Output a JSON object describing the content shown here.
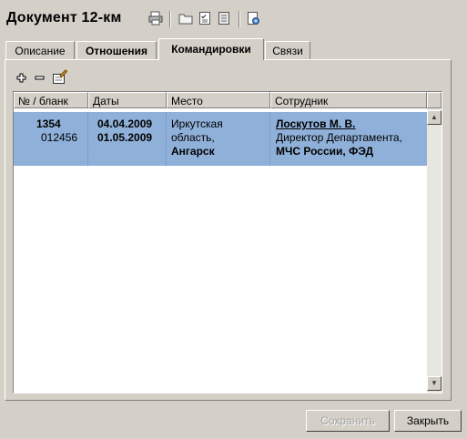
{
  "window": {
    "title": "Документ 12-км"
  },
  "toolbar": {
    "icons": [
      "print-icon",
      "folder-icon",
      "checklist-icon",
      "document-icon",
      "report-icon"
    ]
  },
  "tabs": [
    {
      "label": "Описание",
      "active": false
    },
    {
      "label": "Отношения",
      "active": false
    },
    {
      "label": "Командировки",
      "active": true
    },
    {
      "label": "Связи",
      "active": false
    }
  ],
  "panel_toolbar": {
    "icons": [
      "add-icon",
      "remove-icon",
      "edit-icon"
    ]
  },
  "grid": {
    "columns": [
      "№ / бланк",
      "Даты",
      "Место",
      "Сотрудник"
    ],
    "rows": [
      {
        "number": "1354",
        "blank": "012456",
        "date_from": "04.04.2009",
        "date_to": "01.05.2009",
        "place_line1": "Иркутская",
        "place_line2": "область,",
        "place_city": "Ангарск",
        "employee_name": "Лоскутов М. В.",
        "employee_position": "Директор Департамента,",
        "employee_org": "МЧС России, ФЭД"
      }
    ]
  },
  "buttons": {
    "save": "Сохранить",
    "close": "Закрыть"
  },
  "colors": {
    "selection": "#8fb0d8",
    "background": "#d4d0c8"
  }
}
